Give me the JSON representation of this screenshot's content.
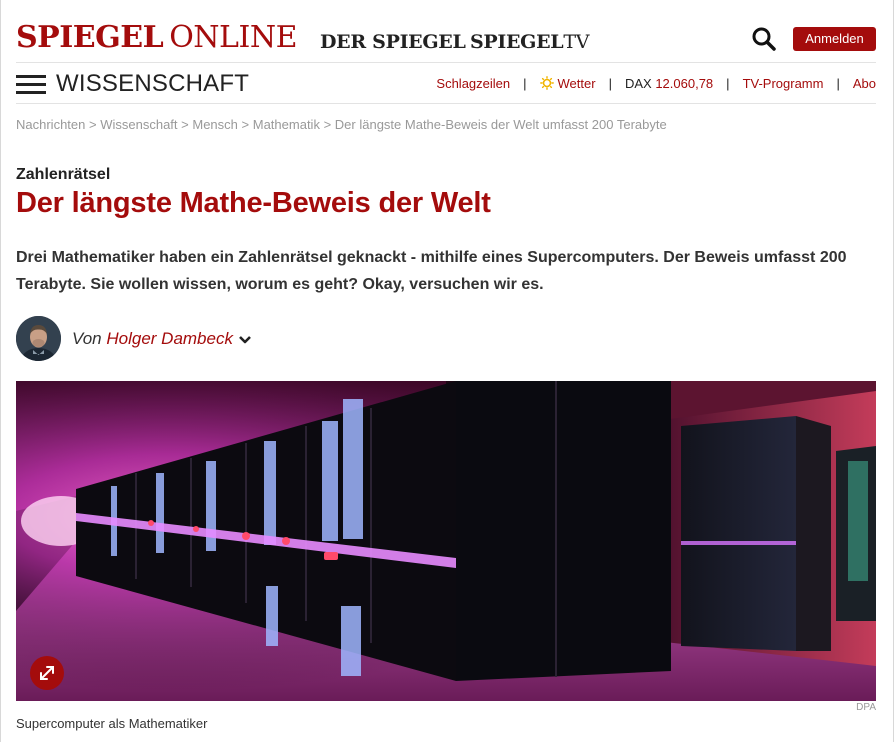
{
  "header": {
    "logo_main": "SPIEGEL",
    "logo_online": "ONLINE",
    "brand_der_spiegel": "DER SPIEGEL",
    "brand_spiegel_tv_main": "SPIEGEL",
    "brand_spiegel_tv_suffix": "TV",
    "login_label": "Anmelden"
  },
  "nav": {
    "section_title": "WISSENSCHAFT",
    "links": {
      "schlagzeilen": "Schlagzeilen",
      "wetter": "Wetter",
      "dax_label": "DAX",
      "dax_value": "12.060,78",
      "tv_programm": "TV-Programm",
      "abo": "Abo"
    },
    "separator": "|"
  },
  "breadcrumb": {
    "items": [
      "Nachrichten",
      "Wissenschaft",
      "Mensch",
      "Mathematik",
      "Der längste Mathe-Beweis der Welt umfasst 200 Terabyte"
    ],
    "separator": ">"
  },
  "article": {
    "kicker": "Zahlenrätsel",
    "headline": "Der längste Mathe-Beweis der Welt",
    "intro": "Drei Mathematiker haben ein Zahlenrätsel geknackt - mithilfe eines Supercomputers. Der Beweis umfasst 200 Terabyte. Sie wollen wissen, worum es geht? Okay, versuchen wir es.",
    "byline_prefix": "Von",
    "author": "Holger Dambeck"
  },
  "image": {
    "credit": "DPA",
    "caption": "Supercomputer als Mathematiker"
  },
  "colors": {
    "brand_red": "#a40c0c",
    "text_dark": "#222222",
    "breadcrumb_gray": "#999999"
  }
}
